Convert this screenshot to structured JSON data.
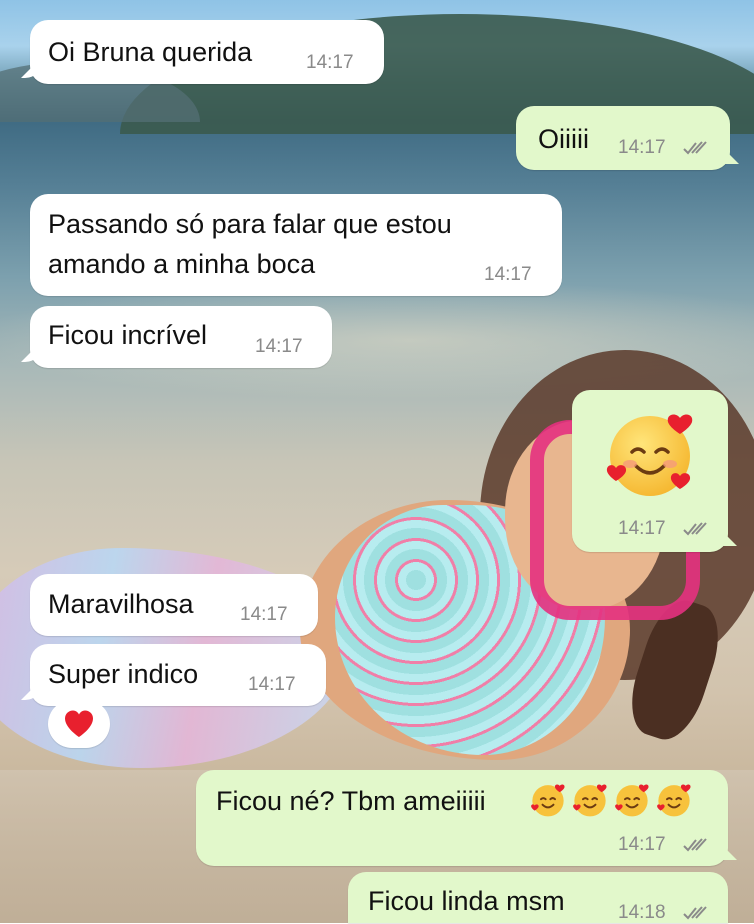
{
  "chat": {
    "messages": [
      {
        "text": "Oi Bruna querida",
        "time": "14:17"
      },
      {
        "text": "Oiiiii",
        "time": "14:17"
      },
      {
        "line1": "Passando só para falar que estou",
        "line2": "amando a minha boca",
        "time": "14:17"
      },
      {
        "text": "Ficou incrível",
        "time": "14:17"
      },
      {
        "emoji": "smiling-face-with-hearts",
        "time": "14:17"
      },
      {
        "text": "Maravilhosa",
        "time": "14:17"
      },
      {
        "text": "Super indico",
        "time": "14:17"
      },
      {
        "reaction": "red-heart"
      },
      {
        "text": "Ficou né? Tbm ameiiiii",
        "emojis": [
          "smiling-face-with-hearts",
          "smiling-face-with-hearts",
          "smiling-face-with-hearts",
          "smiling-face-with-hearts"
        ],
        "time": "14:17"
      },
      {
        "text": "Ficou linda msm",
        "time": "14:18"
      }
    ]
  },
  "icons": {
    "read_receipt": "double-check-icon",
    "reaction": "red-heart-icon"
  },
  "colors": {
    "incoming_bubble": "#ffffff",
    "outgoing_bubble": "#e2f8cb",
    "timestamp": "#8a8a8a",
    "tick": "#8a8a8a"
  }
}
